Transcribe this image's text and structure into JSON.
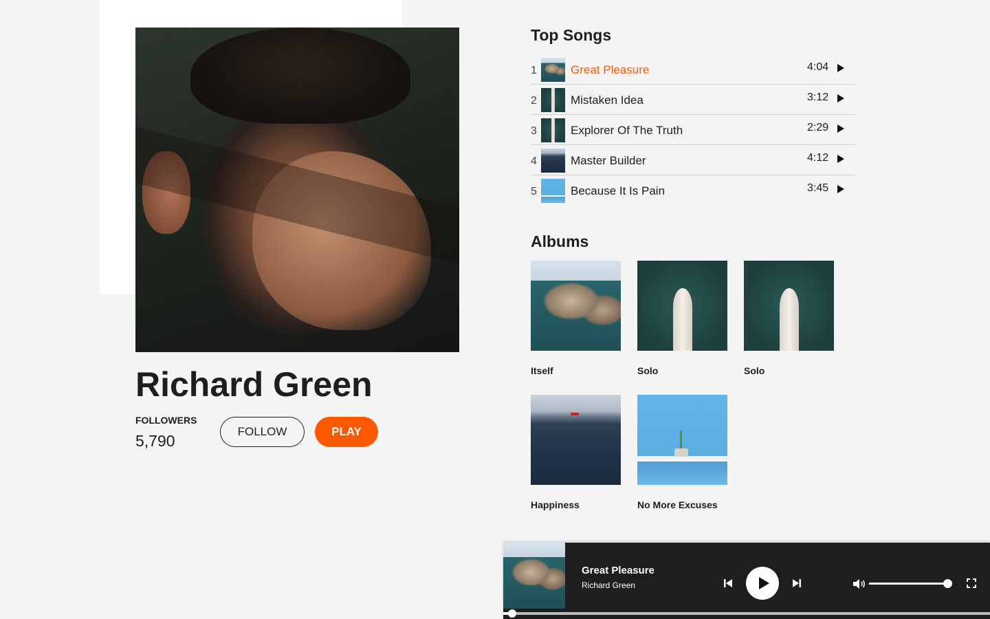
{
  "artist": {
    "name": "Richard Green",
    "followers_label": "FOLLOWERS",
    "followers_count": "5,790",
    "follow_label": "FOLLOW",
    "play_label": "PLAY"
  },
  "top_songs": {
    "title": "Top Songs",
    "items": [
      {
        "num": "1",
        "name": "Great Pleasure",
        "time": "4:04",
        "active": true
      },
      {
        "num": "2",
        "name": "Mistaken Idea",
        "time": "3:12"
      },
      {
        "num": "3",
        "name": "Explorer Of The Truth",
        "time": "2:29"
      },
      {
        "num": "4",
        "name": "Master Builder",
        "time": "4:12"
      },
      {
        "num": "5",
        "name": "Because It Is Pain",
        "time": "3:45"
      }
    ]
  },
  "albums": {
    "title": "Albums",
    "items": [
      {
        "name": "Itself"
      },
      {
        "name": "Solo"
      },
      {
        "name": "Solo"
      },
      {
        "name": "Happiness"
      },
      {
        "name": "No More Excuses"
      }
    ]
  },
  "player": {
    "track": "Great Pleasure",
    "artist": "Richard Green",
    "volume_fraction": 1.0,
    "progress_fraction": 0.01
  },
  "colors": {
    "accent": "#ff5a00",
    "player_bg": "#1e1e1e",
    "page_bg": "#f4f4f4"
  }
}
